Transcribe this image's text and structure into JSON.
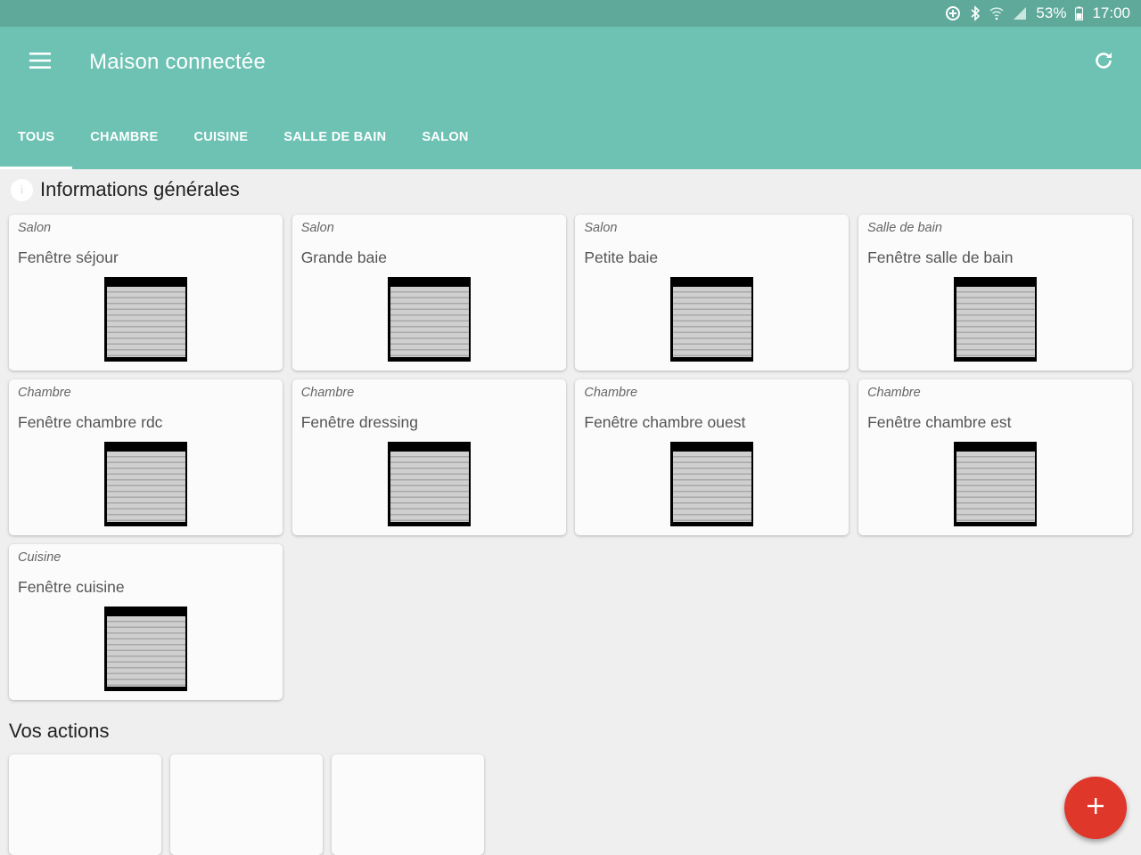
{
  "status_bar": {
    "battery_percent": "53%",
    "time": "17:00",
    "icons": [
      "data-saver-icon",
      "bluetooth-icon",
      "wifi-icon",
      "signal-icon",
      "battery-icon"
    ]
  },
  "app_bar": {
    "title": "Maison connectée",
    "menu_icon": "hamburger-menu-icon",
    "refresh_icon": "refresh-icon",
    "background_color": "#6dc2b3"
  },
  "tabs": [
    {
      "label": "TOUS",
      "active": true
    },
    {
      "label": "CHAMBRE",
      "active": false
    },
    {
      "label": "CUISINE",
      "active": false
    },
    {
      "label": "SALLE DE BAIN",
      "active": false
    },
    {
      "label": "SALON",
      "active": false
    }
  ],
  "section": {
    "title": "Informations générales",
    "icon": "info-icon"
  },
  "cards": [
    {
      "room": "Salon",
      "name": "Fenêtre séjour",
      "icon": "shutter-icon"
    },
    {
      "room": "Salon",
      "name": "Grande baie",
      "icon": "shutter-icon"
    },
    {
      "room": "Salon",
      "name": "Petite baie",
      "icon": "shutter-icon"
    },
    {
      "room": "Salle de bain",
      "name": "Fenêtre salle de bain",
      "icon": "shutter-icon"
    },
    {
      "room": "Chambre",
      "name": "Fenêtre chambre rdc",
      "icon": "shutter-icon"
    },
    {
      "room": "Chambre",
      "name": "Fenêtre dressing",
      "icon": "shutter-icon"
    },
    {
      "room": "Chambre",
      "name": "Fenêtre chambre ouest",
      "icon": "shutter-icon"
    },
    {
      "room": "Chambre",
      "name": "Fenêtre chambre est",
      "icon": "shutter-icon"
    },
    {
      "room": "Cuisine",
      "name": "Fenêtre cuisine",
      "icon": "shutter-icon"
    }
  ],
  "actions": {
    "title": "Vos actions",
    "count": 3
  },
  "fab": {
    "icon": "plus-icon",
    "color": "#e0372b"
  }
}
